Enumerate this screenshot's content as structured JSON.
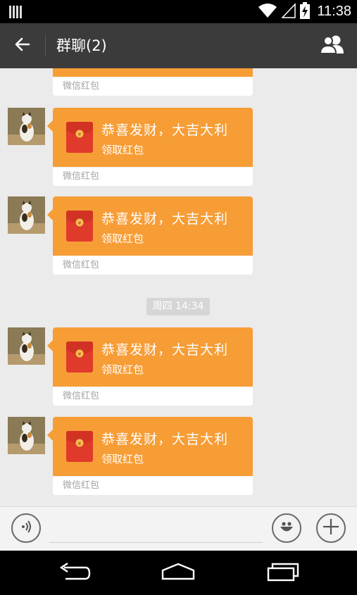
{
  "status": {
    "time": "11:38"
  },
  "header": {
    "title": "群聊(2)"
  },
  "partial_card": {
    "footer": "微信红包"
  },
  "messages": [
    {
      "title": "恭喜发财，大吉大利",
      "action": "领取红包",
      "footer": "微信红包"
    },
    {
      "title": "恭喜发财，大吉大利",
      "action": "领取红包",
      "footer": "微信红包"
    },
    {
      "title": "恭喜发财，大吉大利",
      "action": "领取红包",
      "footer": "微信红包"
    },
    {
      "title": "恭喜发财，大吉大利",
      "action": "领取红包",
      "footer": "微信红包"
    }
  ],
  "time_divider": "周四 14:34",
  "colors": {
    "card_orange": "#f79d36",
    "envelope_red": "#e03a2b",
    "header_bg": "#3b3b3b",
    "chat_bg": "#ebebeb"
  },
  "icons": [
    "sim-card-icon",
    "wifi-icon",
    "signal-icon",
    "battery-charging-icon",
    "back-arrow-icon",
    "group-members-icon",
    "red-envelope-icon",
    "voice-icon",
    "emoji-icon",
    "plus-icon",
    "nav-back-icon",
    "nav-home-icon",
    "nav-recents-icon"
  ]
}
